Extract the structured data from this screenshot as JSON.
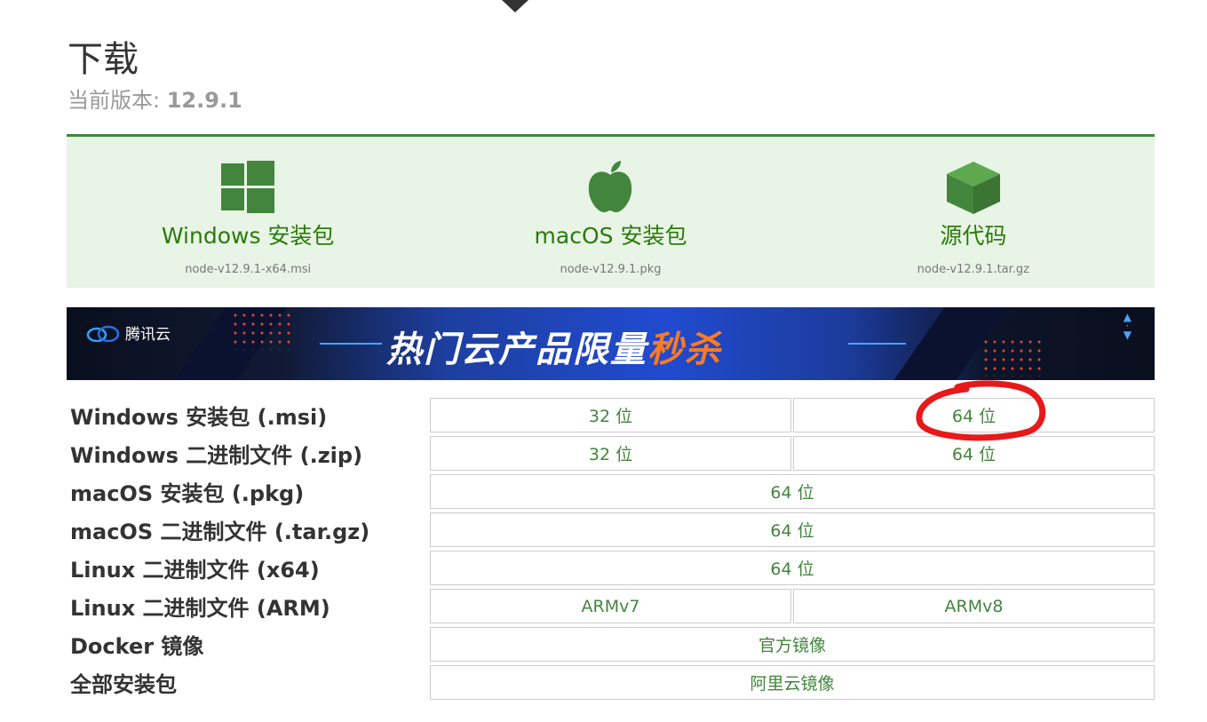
{
  "page": {
    "title": "下载",
    "version_label": "当前版本:",
    "version_value": "12.9.1"
  },
  "downloads": [
    {
      "icon": "windows-icon",
      "label": "Windows 安装包",
      "file": "node-v12.9.1-x64.msi"
    },
    {
      "icon": "apple-icon",
      "label": "macOS 安装包",
      "file": "node-v12.9.1.pkg"
    },
    {
      "icon": "source-box-icon",
      "label": "源代码",
      "file": "node-v12.9.1.tar.gz"
    }
  ],
  "banner": {
    "brand": "腾讯云",
    "headline": "热门云产品限量",
    "highlight": "秒杀"
  },
  "table": [
    {
      "label": "Windows 安装包 (.msi)",
      "cells": [
        "32 位",
        "64 位"
      ]
    },
    {
      "label": "Windows 二进制文件 (.zip)",
      "cells": [
        "32 位",
        "64 位"
      ]
    },
    {
      "label": "macOS 安装包 (.pkg)",
      "cells": [
        "64 位"
      ]
    },
    {
      "label": "macOS 二进制文件 (.tar.gz)",
      "cells": [
        "64 位"
      ]
    },
    {
      "label": "Linux 二进制文件 (x64)",
      "cells": [
        "64 位"
      ]
    },
    {
      "label": "Linux 二进制文件 (ARM)",
      "cells": [
        "ARMv7",
        "ARMv8"
      ]
    },
    {
      "label": "Docker 镜像",
      "cells": [
        "官方镜像"
      ]
    },
    {
      "label": "全部安装包",
      "cells": [
        "阿里云镜像"
      ]
    }
  ],
  "colors": {
    "accent_green": "#43853d",
    "strip_bg": "#e8f5e6",
    "annotation_red": "#e8181b"
  }
}
